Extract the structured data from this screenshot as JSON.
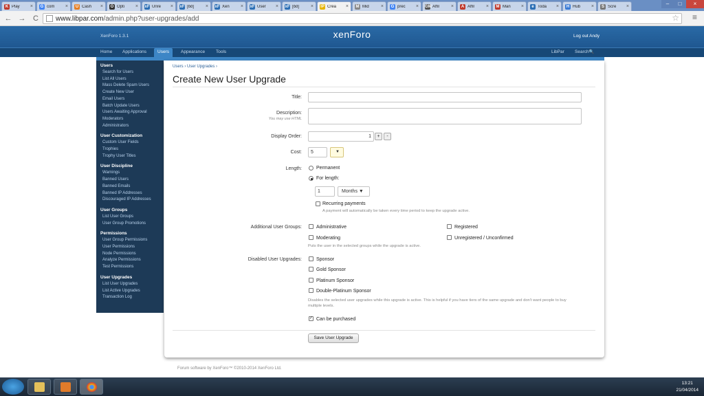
{
  "browser": {
    "tabs": [
      {
        "label": "Play",
        "icon_color": "#c0392b",
        "icon_char": "K",
        "active": false
      },
      {
        "label": "com",
        "icon_color": "#4285f4",
        "icon_char": "G",
        "active": false
      },
      {
        "label": "Cash",
        "icon_color": "#e67e22",
        "icon_char": "U",
        "active": false
      },
      {
        "label": "Opti",
        "icon_color": "#333333",
        "icon_char": "O",
        "active": false
      },
      {
        "label": "Unre",
        "icon_color": "#2c6fb5",
        "icon_char": "xF",
        "active": false
      },
      {
        "label": "[bd]",
        "icon_color": "#2c6fb5",
        "icon_char": "xF",
        "active": false
      },
      {
        "label": "Xen",
        "icon_color": "#2c6fb5",
        "icon_char": "xF",
        "active": false
      },
      {
        "label": "User",
        "icon_color": "#2c6fb5",
        "icon_char": "xF",
        "active": false
      },
      {
        "label": "[bd]",
        "icon_color": "#2c6fb5",
        "icon_char": "xF",
        "active": false
      },
      {
        "label": "Crea",
        "icon_color": "#e6b400",
        "icon_char": "lP",
        "active": true
      },
      {
        "label": "Mid",
        "icon_color": "#888888",
        "icon_char": "M",
        "active": false
      },
      {
        "label": "prec",
        "icon_color": "#4285f4",
        "icon_char": "G",
        "active": false
      },
      {
        "label": "Affil",
        "icon_color": "#555555",
        "icon_char": "GM",
        "active": false
      },
      {
        "label": "Affil",
        "icon_color": "#c0392b",
        "icon_char": "A",
        "active": false
      },
      {
        "label": "Man",
        "icon_color": "#c0392b",
        "icon_char": "M",
        "active": false
      },
      {
        "label": "Toda",
        "icon_color": "#2c6fb5",
        "icon_char": "e",
        "active": false
      },
      {
        "label": "Hub",
        "icon_color": "#3a7bd5",
        "icon_char": "H",
        "active": false
      },
      {
        "label": "Scre",
        "icon_color": "#777777",
        "icon_char": "S",
        "active": false
      }
    ],
    "url_domain": "www.libpar.com",
    "url_path": "/admin.php?user-upgrades/add",
    "back_icon": "←",
    "forward_icon": "→",
    "reload_icon": "C",
    "star_icon": "☆",
    "menu_icon": "≡",
    "tab_close": "×",
    "win_min": "–",
    "win_max": "□",
    "win_close": "×"
  },
  "xf": {
    "version": "XenForo 1.3.1",
    "logo": "xenForo",
    "logout": "Log out Andy",
    "nav": [
      "Home",
      "Applications",
      "Users",
      "Appearance",
      "Tools"
    ],
    "nav_selected": "Users",
    "libpar": "LibPar",
    "search": "Search",
    "search_icon": "🔍"
  },
  "sidebar": {
    "groups": [
      {
        "heading": "Users",
        "items": [
          "Search for Users",
          "List All Users",
          "Mass Delete Spam Users",
          "Create New User",
          "Email Users",
          "Batch Update Users",
          "Users Awaiting Approval",
          "Moderators",
          "Administrators"
        ]
      },
      {
        "heading": "User Customization",
        "items": [
          "Custom User Fields",
          "Trophies",
          "Trophy User Titles"
        ]
      },
      {
        "heading": "User Discipline",
        "items": [
          "Warnings",
          "Banned Users",
          "Banned Emails",
          "Banned IP Addresses",
          "Discouraged IP Addresses"
        ]
      },
      {
        "heading": "User Groups",
        "items": [
          "List User Groups",
          "User Group Promotions"
        ]
      },
      {
        "heading": "Permissions",
        "items": [
          "User Group Permissions",
          "User Permissions",
          "Node Permissions",
          "Analyze Permissions",
          "Test Permissions"
        ]
      },
      {
        "heading": "User Upgrades",
        "items": [
          "List User Upgrades",
          "List Active Upgrades",
          "Transaction Log"
        ]
      }
    ]
  },
  "form": {
    "breadcrumb": "Users ›   User Upgrades ›",
    "title": "Create New User Upgrade",
    "title_label": "Title:",
    "title_value": "",
    "description_label": "Description:",
    "description_hint": "You may use HTML",
    "description_value": "",
    "display_order_label": "Display Order:",
    "display_order_value": "1",
    "plus": "+",
    "minus": "-",
    "cost_label": "Cost:",
    "cost_value": "5",
    "currency_arrow": "▼",
    "length_label": "Length:",
    "permanent": "Permanent",
    "for_length": "For length:",
    "length_value": "1",
    "length_unit": "Months ▼",
    "recurring": "Recurring payments",
    "recurring_hint": "A payment will automatically be taken every time period to keep the upgrade active.",
    "additional_label": "Additional User Groups:",
    "groups": [
      "Administrative",
      "Registered",
      "Moderating",
      "Unregistered / Unconfirmed"
    ],
    "groups_hint": "Puts the user in the selected groups while the upgrade is active.",
    "disabled_label": "Disabled User Upgrades:",
    "upgrades": [
      "Sponsor",
      "Gold Sponsor",
      "Platinum Sponsor",
      "Double-Platinum Sponsor"
    ],
    "disabled_hint": "Disables the selected user upgrades while this upgrade is active. This is helpful if you have tiers of the same upgrade and don't want people to buy multiple levels.",
    "can_purchase": "Can be purchased",
    "check_mark": "✓",
    "save": "Save User Upgrade"
  },
  "footer": "Forum software by XenForo™ ©2010-2014 XenForo Ltd.",
  "taskbar": {
    "time": "13:21",
    "date": "21/04/2014"
  }
}
